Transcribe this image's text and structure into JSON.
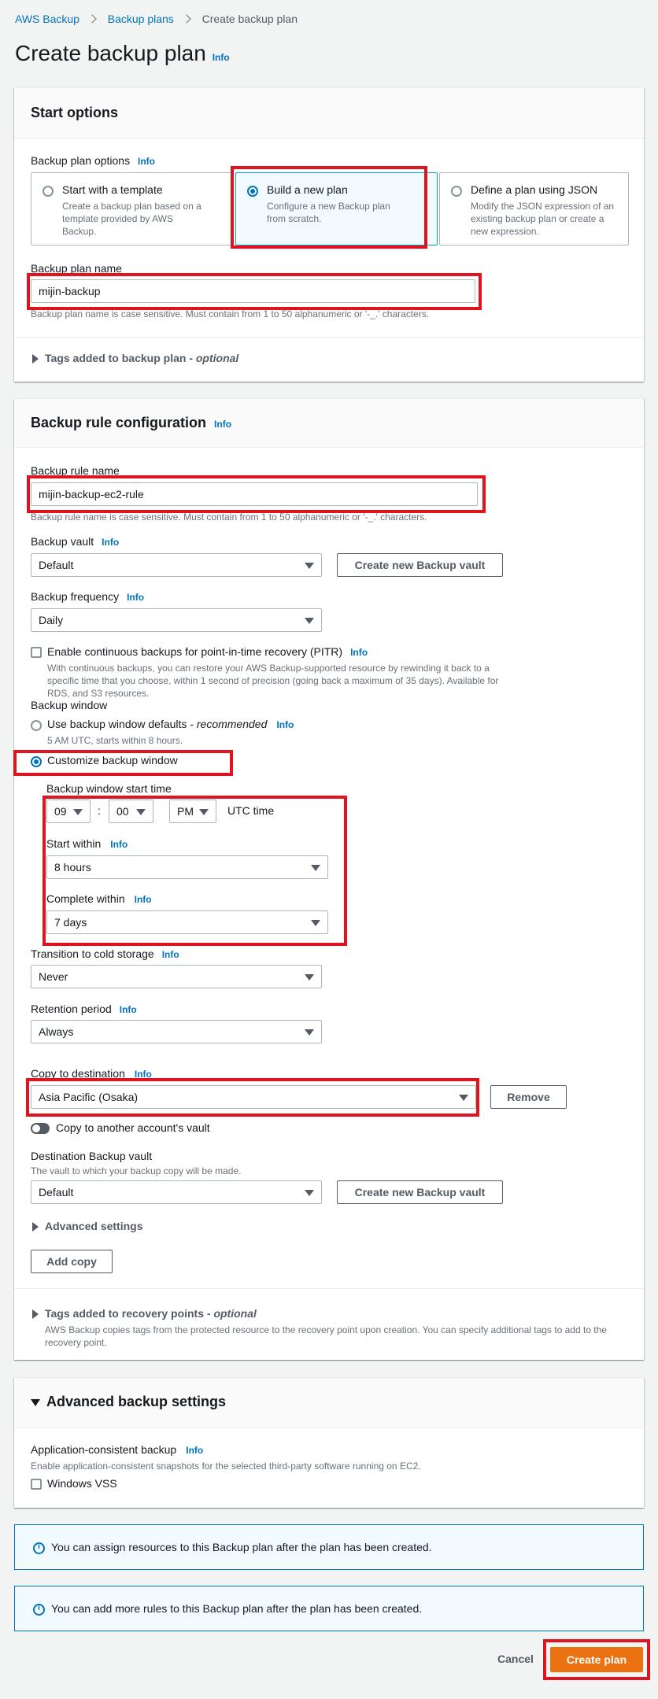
{
  "breadcrumb": {
    "items": [
      "AWS Backup",
      "Backup plans",
      "Create backup plan"
    ]
  },
  "page": {
    "title": "Create backup plan",
    "info": "Info"
  },
  "start_options": {
    "title": "Start options",
    "options_label": "Backup plan options",
    "info": "Info",
    "cards": [
      {
        "title": "Start with a template",
        "desc": "Create a backup plan based on a template provided by AWS Backup.",
        "selected": false
      },
      {
        "title": "Build a new plan",
        "desc": "Configure a new Backup plan from scratch.",
        "selected": true
      },
      {
        "title": "Define a plan using JSON",
        "desc": "Modify the JSON expression of an existing backup plan or create a new expression.",
        "selected": false
      }
    ],
    "name_label": "Backup plan name",
    "name_value": "mijin-backup",
    "name_hint": "Backup plan name is case sensitive. Must contain from 1 to 50 alphanumeric or '-_.' characters.",
    "tags_label": "Tags added to backup plan - ",
    "tags_optional": "optional"
  },
  "rule": {
    "title": "Backup rule configuration",
    "info": "Info",
    "name_label": "Backup rule name",
    "name_value": "mijin-backup-ec2-rule",
    "name_hint": "Backup rule name is case sensitive. Must contain from 1 to 50 alphanumeric or '-_.' characters.",
    "vault_label": "Backup vault",
    "vault_value": "Default",
    "create_vault_btn": "Create new Backup vault",
    "freq_label": "Backup frequency",
    "freq_value": "Daily",
    "pitr_label": "Enable continuous backups for point-in-time recovery (PITR)",
    "pitr_desc": "With continuous backups, you can restore your AWS Backup-supported resource by rewinding it back to a specific time that you choose, within 1 second of precision (going back a maximum of 35 days). Available for RDS, and S3 resources.",
    "window_label": "Backup window",
    "window_default_label": "Use backup window defaults - ",
    "window_default_rec": "recommended",
    "window_default_hint": "5 AM UTC, starts within 8 hours.",
    "window_custom_label": "Customize backup window",
    "start_time_label": "Backup window start time",
    "hour": "09",
    "colon": ":",
    "minute": "00",
    "ampm": "PM",
    "utc": "UTC time",
    "start_within_label": "Start within",
    "start_within_value": "8 hours",
    "complete_within_label": "Complete within",
    "complete_within_value": "7 days",
    "cold_label": "Transition to cold storage",
    "cold_value": "Never",
    "retention_label": "Retention period",
    "retention_value": "Always",
    "copy_label": "Copy to destination",
    "copy_value": "Asia Pacific (Osaka)",
    "remove_btn": "Remove",
    "copy_other_label": "Copy to another account's vault",
    "dest_vault_label": "Destination Backup vault",
    "dest_vault_hint": "The vault to which your backup copy will be made.",
    "dest_vault_value": "Default",
    "create_vault_btn2": "Create new Backup vault",
    "advanced_label": "Advanced settings",
    "add_copy_btn": "Add copy",
    "rp_tags_label": "Tags added to recovery points - ",
    "rp_tags_optional": "optional",
    "rp_tags_desc": "AWS Backup copies tags from the protected resource to the recovery point upon creation. You can specify additional tags to add to the recovery point."
  },
  "advanced": {
    "title": "Advanced backup settings",
    "app_label": "Application-consistent backup",
    "info": "Info",
    "app_desc": "Enable application-consistent snapshots for the selected third-party software running on EC2.",
    "vss_label": "Windows VSS"
  },
  "flashes": [
    "You can assign resources to this Backup plan after the plan has been created.",
    "You can add more rules to this Backup plan after the plan has been created."
  ],
  "footer": {
    "cancel": "Cancel",
    "create": "Create plan"
  },
  "colors": {
    "primary": "#ec7211",
    "link": "#0073bb",
    "annotation": "#e0141e"
  }
}
